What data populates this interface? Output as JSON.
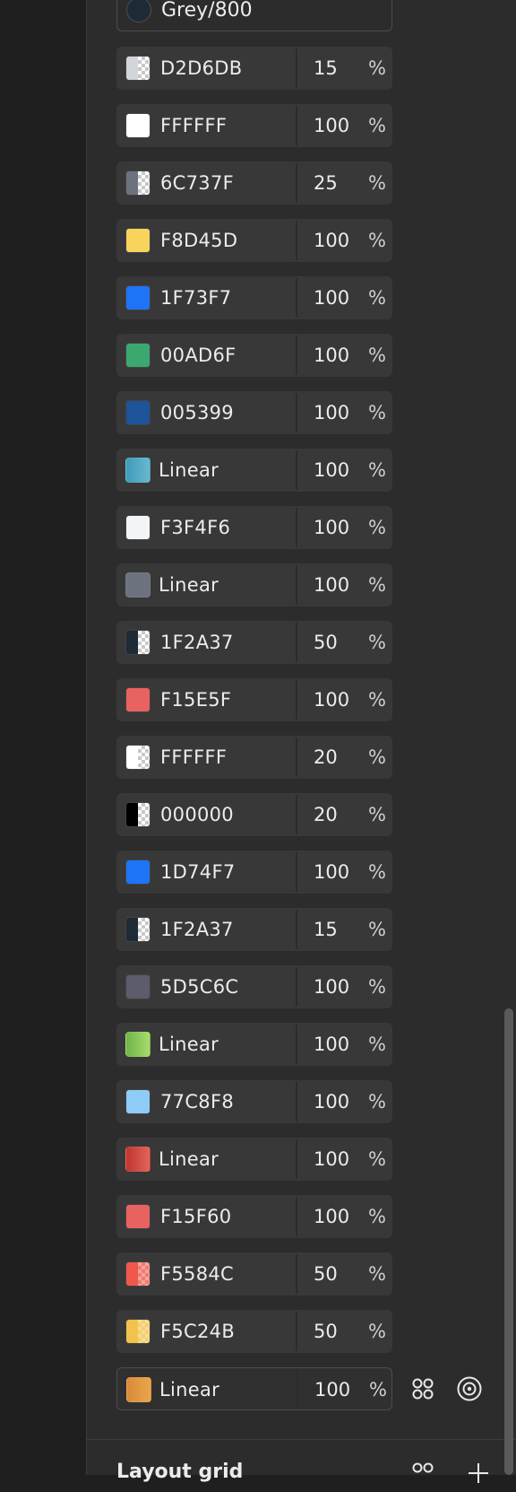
{
  "style_row": {
    "label": "Grey/800"
  },
  "percent_symbol": "%",
  "fills": [
    {
      "hex": "D2D6DB",
      "opacity": "15",
      "swatch_left": "#d2d6db",
      "swatch_right": "checker"
    },
    {
      "hex": "FFFFFF",
      "opacity": "100",
      "swatch_left": "#ffffff",
      "swatch_right": "#ffffff"
    },
    {
      "hex": "6C737F",
      "opacity": "25",
      "swatch_left": "#6c737f",
      "swatch_right": "checker"
    },
    {
      "hex": "F8D45D",
      "opacity": "100",
      "swatch_left": "#f8d45d",
      "swatch_right": "#f8d45d"
    },
    {
      "hex": "1F73F7",
      "opacity": "100",
      "swatch_left": "#1f73f7",
      "swatch_right": "#1f73f7"
    },
    {
      "hex": "00AD6F",
      "opacity": "100",
      "swatch_left": "#3aa86f",
      "swatch_right": "#3aa86f"
    },
    {
      "hex": "005399",
      "opacity": "100",
      "swatch_left": "#1d5399",
      "swatch_right": "#1d5399"
    },
    {
      "hex": "Linear",
      "opacity": "100",
      "swatch_left": "#3f9bbd",
      "swatch_right": "#6ab8cc"
    },
    {
      "hex": "F3F4F6",
      "opacity": "100",
      "swatch_left": "#f3f4f6",
      "swatch_right": "#f3f4f6"
    },
    {
      "hex": "Linear",
      "opacity": "100",
      "swatch_left": "#6c737f",
      "swatch_right": "#6c737f"
    },
    {
      "hex": "1F2A37",
      "opacity": "50",
      "swatch_left": "#1f2a37",
      "swatch_right": "checker"
    },
    {
      "hex": "F15E5F",
      "opacity": "100",
      "swatch_left": "#e96262",
      "swatch_right": "#e96262"
    },
    {
      "hex": "FFFFFF",
      "opacity": "20",
      "swatch_left": "#ffffff",
      "swatch_right": "checker"
    },
    {
      "hex": "000000",
      "opacity": "20",
      "swatch_left": "#000000",
      "swatch_right": "checker"
    },
    {
      "hex": "1D74F7",
      "opacity": "100",
      "swatch_left": "#1d74f7",
      "swatch_right": "#1d74f7"
    },
    {
      "hex": "1F2A37",
      "opacity": "15",
      "swatch_left": "#1f2a37",
      "swatch_right": "checker"
    },
    {
      "hex": "5D5C6C",
      "opacity": "100",
      "swatch_left": "#5d5c6c",
      "swatch_right": "#5d5c6c"
    },
    {
      "hex": "Linear",
      "opacity": "100",
      "swatch_left": "#6fb44a",
      "swatch_right": "#a7dc6b"
    },
    {
      "hex": "77C8F8",
      "opacity": "100",
      "swatch_left": "#8ecbf6",
      "swatch_right": "#8ecbf6"
    },
    {
      "hex": "Linear",
      "opacity": "100",
      "swatch_left": "#c0352f",
      "swatch_right": "#e0645a"
    },
    {
      "hex": "F15F60",
      "opacity": "100",
      "swatch_left": "#e96262",
      "swatch_right": "#e96262"
    },
    {
      "hex": "F5584C",
      "opacity": "50",
      "swatch_left": "#f0584c",
      "swatch_right": "checker-red"
    },
    {
      "hex": "F5C24B",
      "opacity": "50",
      "swatch_left": "#f2c24b",
      "swatch_right": "checker-yellow"
    },
    {
      "hex": "Linear",
      "opacity": "100",
      "swatch_left": "#d98a3a",
      "swatch_right": "#e9a64a",
      "outlined": true
    }
  ],
  "row_actions": {
    "grid_icon": "style-grid-icon",
    "target_icon": "target-icon"
  },
  "next_section": {
    "title": "Layout grid",
    "icons": [
      "style-grid-icon",
      "plus-icon"
    ]
  }
}
